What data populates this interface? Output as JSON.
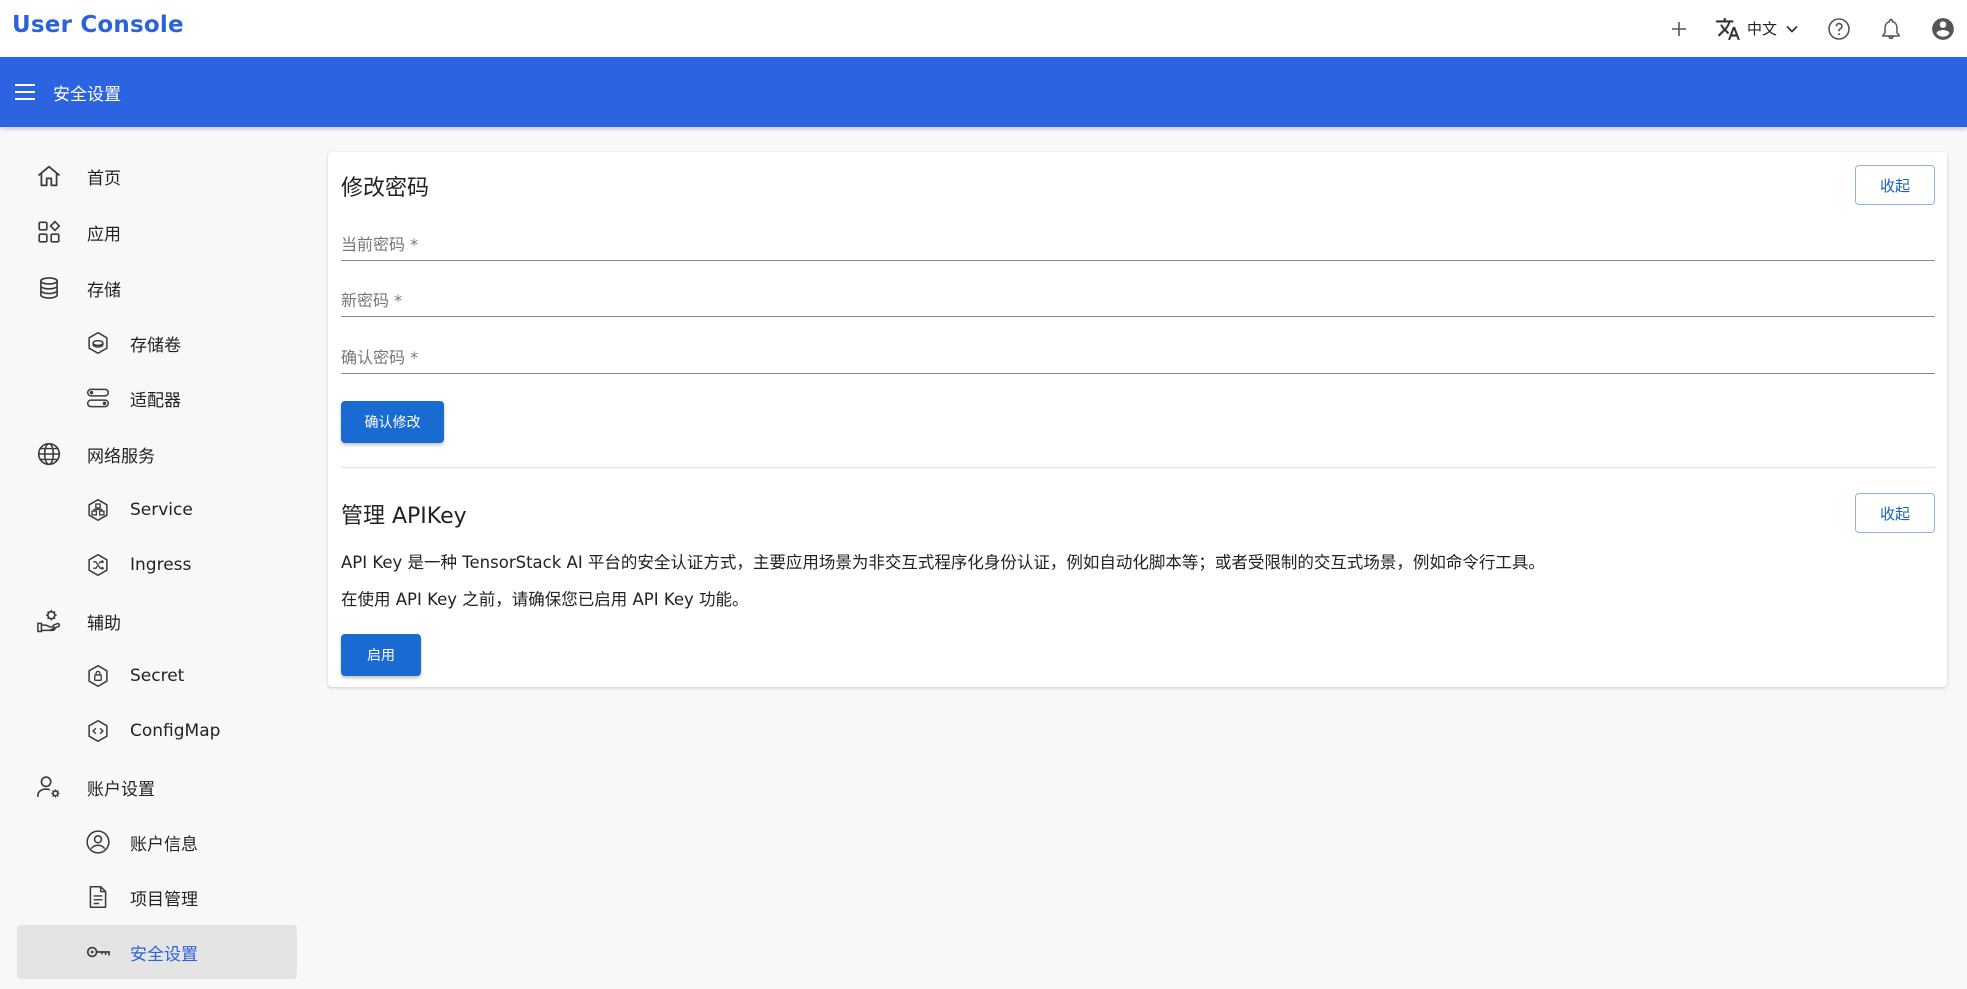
{
  "topbar": {
    "brand": "User Console",
    "language": "中文"
  },
  "appbar": {
    "title": "安全设置"
  },
  "sidebar": {
    "items": [
      {
        "label": "首页",
        "icon": "home-icon",
        "level": "top"
      },
      {
        "label": "应用",
        "icon": "apps-icon",
        "level": "top"
      },
      {
        "label": "存储",
        "icon": "database-icon",
        "level": "top"
      },
      {
        "label": "存储卷",
        "icon": "volume-icon",
        "level": "sub"
      },
      {
        "label": "适配器",
        "icon": "adapter-icon",
        "level": "sub"
      },
      {
        "label": "网络服务",
        "icon": "globe-icon",
        "level": "top"
      },
      {
        "label": "Service",
        "icon": "service-icon",
        "level": "sub"
      },
      {
        "label": "Ingress",
        "icon": "ingress-icon",
        "level": "sub"
      },
      {
        "label": "辅助",
        "icon": "hand-gear-icon",
        "level": "top"
      },
      {
        "label": "Secret",
        "icon": "lock-hexagon-icon",
        "level": "sub"
      },
      {
        "label": "ConfigMap",
        "icon": "code-hexagon-icon",
        "level": "sub"
      },
      {
        "label": "账户设置",
        "icon": "user-gear-icon",
        "level": "top"
      },
      {
        "label": "账户信息",
        "icon": "account-circle-icon",
        "level": "sub"
      },
      {
        "label": "项目管理",
        "icon": "document-icon",
        "level": "sub"
      },
      {
        "label": "安全设置",
        "icon": "key-icon",
        "level": "sub",
        "active": true
      }
    ]
  },
  "password_section": {
    "title": "修改密码",
    "collapse_label": "收起",
    "fields": {
      "current": "当前密码 *",
      "new": "新密码 *",
      "confirm": "确认密码 *"
    },
    "submit_label": "确认修改"
  },
  "apikey_section": {
    "title": "管理 APIKey",
    "collapse_label": "收起",
    "description_1": "API Key 是一种 TensorStack AI 平台的安全认证方式，主要应用场景为非交互式程序化身份认证，例如自动化脚本等；或者受限制的交互式场景，例如命令行工具。",
    "description_2": "在使用 API Key 之前，请确保您已启用 API Key 功能。",
    "enable_label": "启用"
  },
  "colors": {
    "accent": "#2b63e1",
    "brand": "#2b63d9",
    "primary_button": "#1a6bd1"
  }
}
